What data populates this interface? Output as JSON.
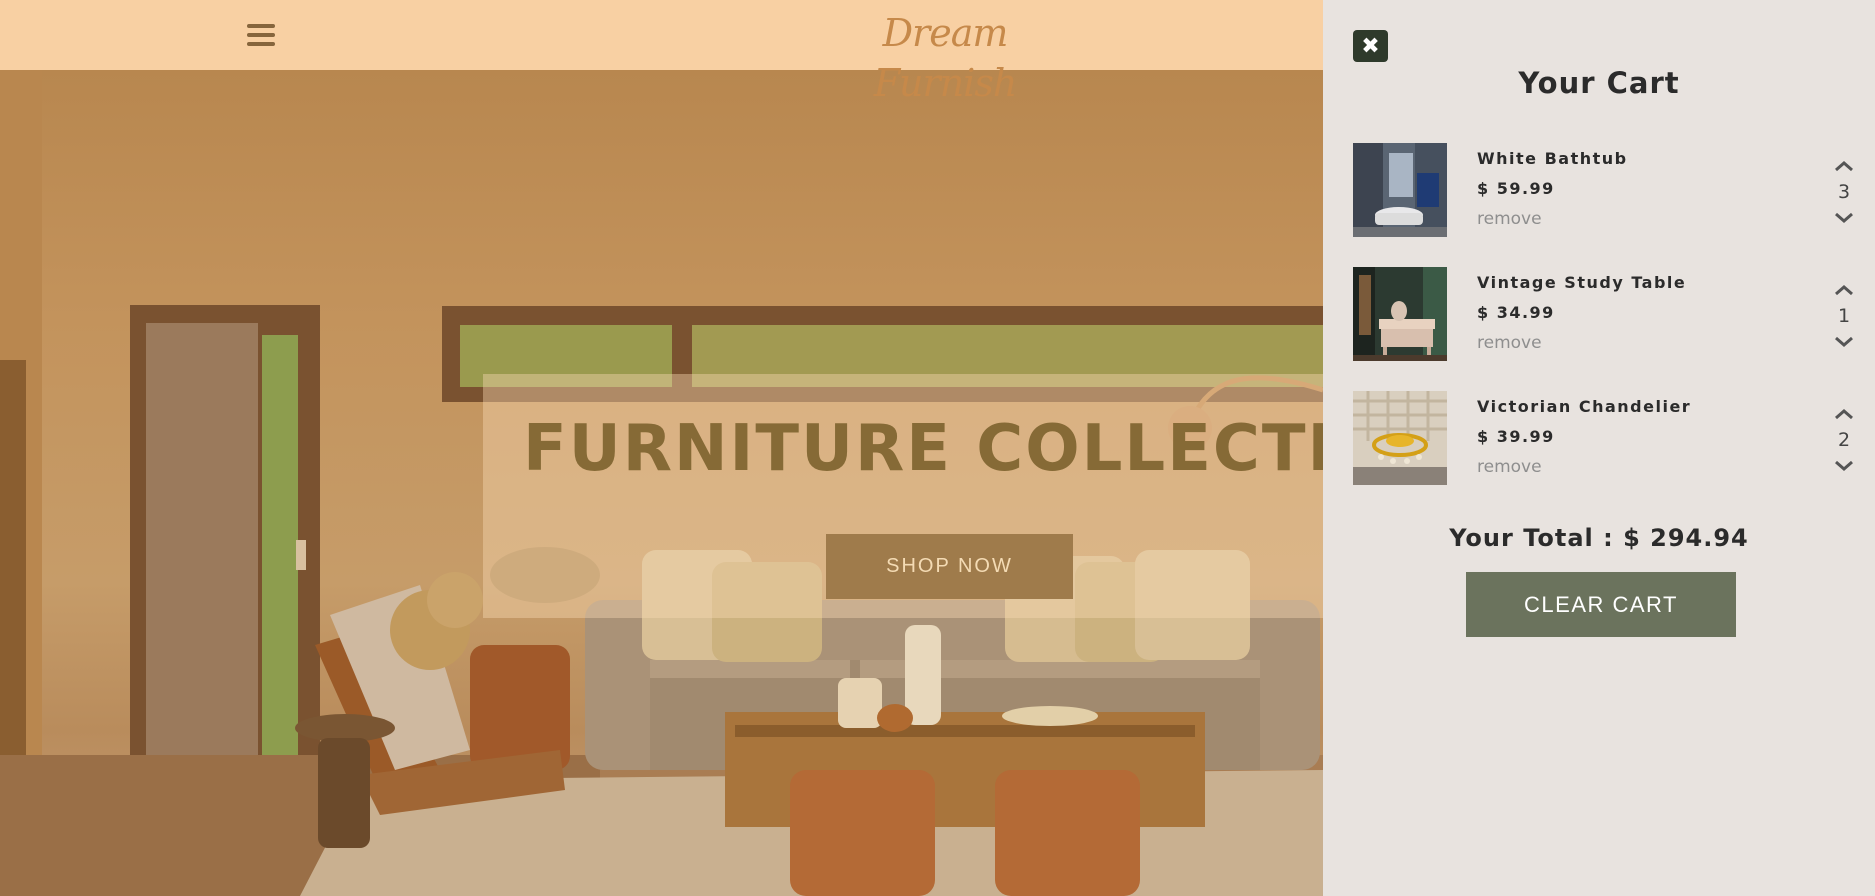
{
  "navbar": {
    "menu_icon": "hamburger-menu-icon",
    "logo": "Dream Furnish",
    "background": "#f8d0a3"
  },
  "hero": {
    "title": "FURNITURE COLLECTION",
    "button_label": "SHOP NOW"
  },
  "cart": {
    "close_icon": "close-x-icon",
    "title": "Your Cart",
    "items": [
      {
        "name": "White Bathtub",
        "price": "$ 59.99",
        "remove_label": "remove",
        "quantity": "3",
        "image": "bathroom-photo"
      },
      {
        "name": "Vintage Study Table",
        "price": "$ 34.99",
        "remove_label": "remove",
        "quantity": "1",
        "image": "study-table-photo"
      },
      {
        "name": "Victorian Chandelier",
        "price": "$ 39.99",
        "remove_label": "remove",
        "quantity": "2",
        "image": "chandelier-photo"
      }
    ],
    "total_label": "Your Total : $ 294.94",
    "clear_label": "CLEAR CART",
    "colors": {
      "panel": "#e8e3df",
      "clear_button": "#6b735d",
      "close_button": "#2e3a2b"
    }
  }
}
